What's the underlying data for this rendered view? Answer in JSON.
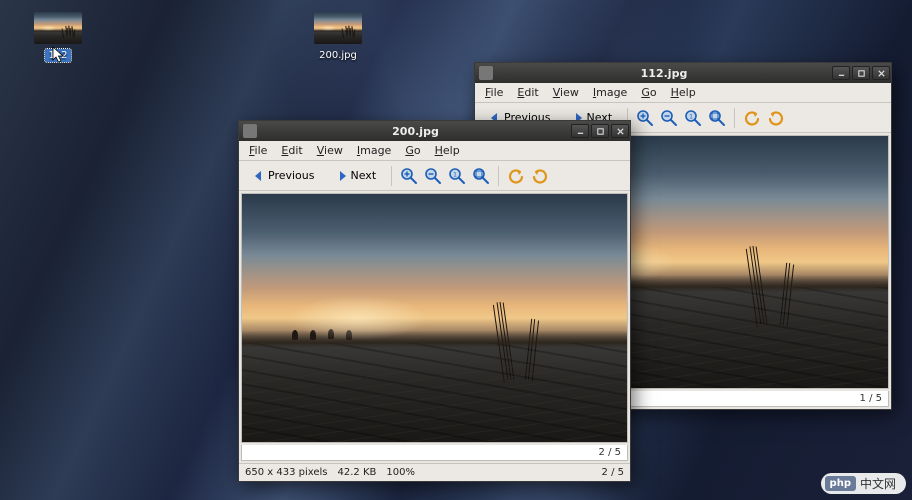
{
  "desktop_icons": [
    {
      "label": "112",
      "selected": true
    },
    {
      "label": "200.jpg",
      "selected": false
    }
  ],
  "menus": {
    "file": "File",
    "edit": "Edit",
    "view": "View",
    "image": "Image",
    "go": "Go",
    "help": "Help"
  },
  "toolbar": {
    "previous": "Previous",
    "next": "Next"
  },
  "window_back": {
    "title": "112.jpg",
    "counter": "1 / 5"
  },
  "window_front": {
    "title": "200.jpg",
    "counter": "2 / 5",
    "status": {
      "dimensions": "650 x 433 pixels",
      "filesize": "42.2 KB",
      "zoom": "100%"
    }
  },
  "watermark": {
    "logo": "php",
    "text": "中文网"
  }
}
